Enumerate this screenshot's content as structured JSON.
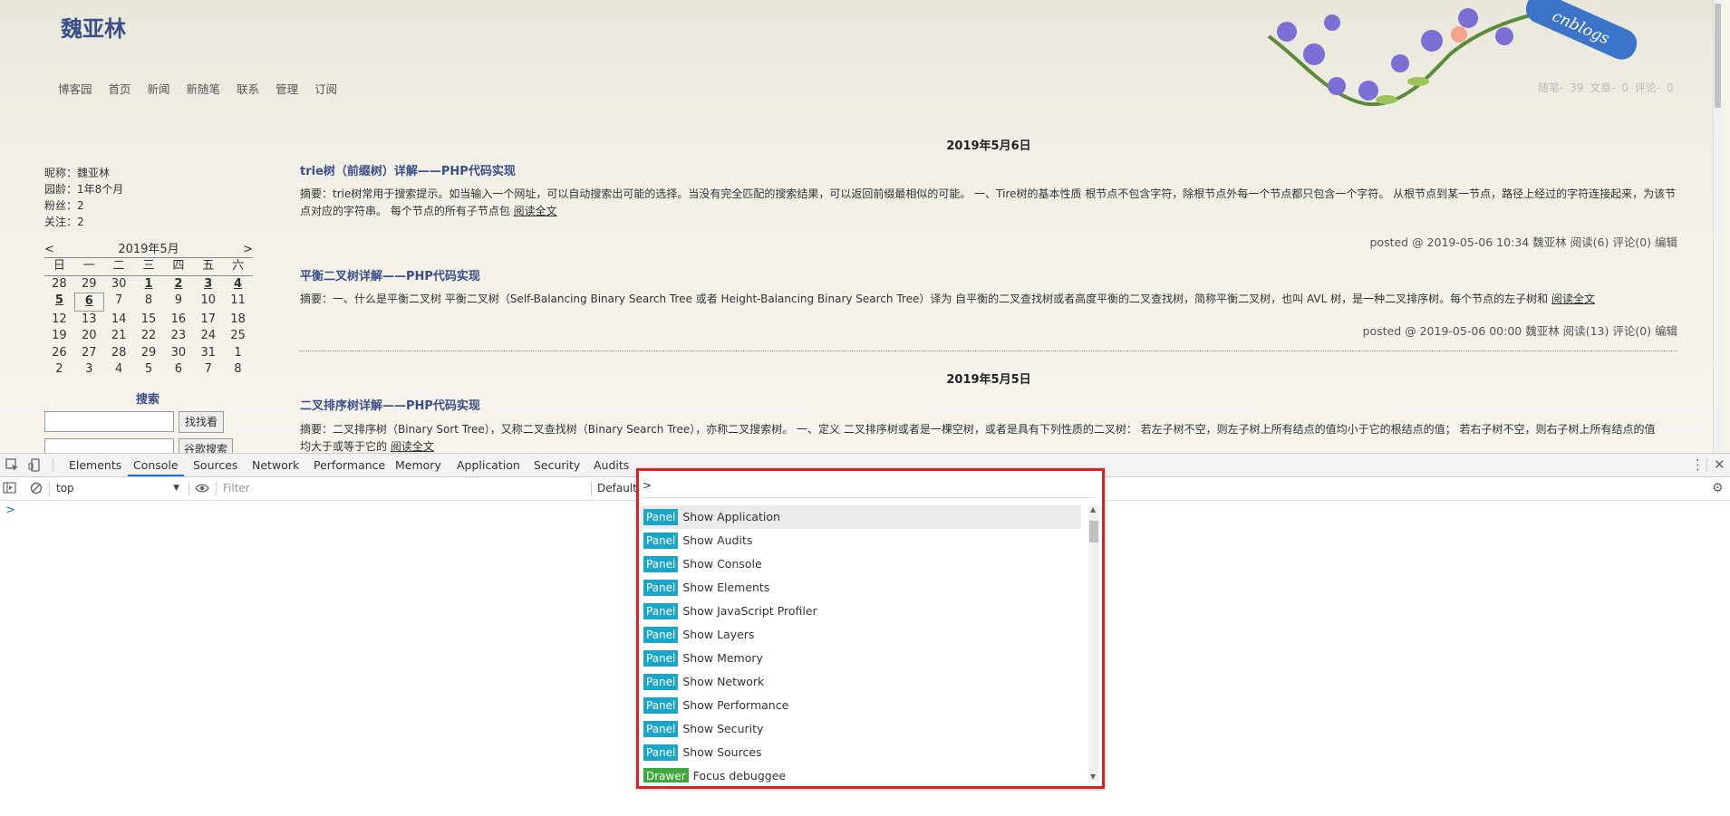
{
  "blog": {
    "title": "魏亚林",
    "nav": [
      "博客园",
      "首页",
      "新闻",
      "新随笔",
      "联系",
      "管理",
      "订阅"
    ],
    "stats": "随笔- 39  文章- 0  评论- 0",
    "logo_text": "cnblogs"
  },
  "sidebar": {
    "profile": [
      "昵称：魏亚林",
      "园龄：1年8个月",
      "粉丝：2",
      "关注：2"
    ],
    "calendar": {
      "prev": "<",
      "month": "2019年5月",
      "next": ">",
      "weekdays": [
        "日",
        "一",
        "二",
        "三",
        "四",
        "五",
        "六"
      ],
      "days": [
        "28",
        "29",
        "30",
        "1",
        "2",
        "3",
        "4",
        "5",
        "6",
        "7",
        "8",
        "9",
        "10",
        "11",
        "12",
        "13",
        "14",
        "15",
        "16",
        "17",
        "18",
        "19",
        "20",
        "21",
        "22",
        "23",
        "24",
        "25",
        "26",
        "27",
        "28",
        "29",
        "30",
        "31",
        "1",
        "2",
        "3",
        "4",
        "5",
        "6",
        "7",
        "8"
      ],
      "linked_days": [
        3,
        4,
        5,
        6,
        7,
        8
      ],
      "today_index": 8
    },
    "search_title": "搜索",
    "search_button": "找找看",
    "google_button": "谷歌搜索"
  },
  "posts": {
    "date1": "2019年5月6日",
    "p1_title": "trie树（前缀树）详解——PHP代码实现",
    "p1_abs_line1": "摘要：trie树常用于搜索提示。如当输入一个网址，可以自动搜索出可能的选择。当没有完全匹配的搜索结果，可以返回前缀最相似的可能。 一、Tire树的基本性质 根节点不包含字符，除根节点外每一个节点都只包含一个字符。 从根节点到某一节点，路径上经过的字符连接起来，为该节",
    "p1_abs_line2": "点对应的字符串。 每个节点的所有子节点包 ",
    "p1_foot": "posted @ 2019-05-06 10:34 魏亚林 阅读(6) 评论(0) 编辑",
    "p2_title": "平衡二叉树详解——PHP代码实现",
    "p2_abs": "摘要：一、什么是平衡二叉树 平衡二叉树（Self-Balancing Binary Search Tree 或者 Height-Balancing Binary Search Tree）译为 自平衡的二叉查找树或者高度平衡的二叉查找树，简称平衡二叉树，也叫 AVL 树，是一种二叉排序树。每个节点的左子树和 ",
    "p2_foot": "posted @ 2019-05-06 00:00 魏亚林 阅读(13) 评论(0) 编辑",
    "date2": "2019年5月5日",
    "p3_title": "二叉排序树详解——PHP代码实现",
    "p3_abs_line1": "摘要：二叉排序树（Binary Sort Tree），又称二叉查找树（Binary Search Tree），亦称二叉搜索树。 一、定义 二叉排序树或者是一棵空树，或者是具有下列性质的二叉树： 若左子树不空，则左子树上所有结点的值均小于它的根结点的值； 若右子树不空，则右子树上所有结点的值",
    "p3_abs_line2": "均大于或等于它的 ",
    "read_more": "阅读全文"
  },
  "devtools": {
    "tabs": [
      "Elements",
      "Console",
      "Sources",
      "Network",
      "Performance",
      "Memory",
      "Application",
      "Security",
      "Audits"
    ],
    "active_tab": "Console",
    "context": "top",
    "filter_placeholder": "Filter",
    "levels": "Default",
    "prompt": ">",
    "command_input": ">",
    "commands": [
      {
        "badge": "Panel",
        "label": "Show Application"
      },
      {
        "badge": "Panel",
        "label": "Show Audits"
      },
      {
        "badge": "Panel",
        "label": "Show Console"
      },
      {
        "badge": "Panel",
        "label": "Show Elements"
      },
      {
        "badge": "Panel",
        "label": "Show JavaScript Profiler"
      },
      {
        "badge": "Panel",
        "label": "Show Layers"
      },
      {
        "badge": "Panel",
        "label": "Show Memory"
      },
      {
        "badge": "Panel",
        "label": "Show Network"
      },
      {
        "badge": "Panel",
        "label": "Show Performance"
      },
      {
        "badge": "Panel",
        "label": "Show Security"
      },
      {
        "badge": "Panel",
        "label": "Show Sources"
      },
      {
        "badge": "Drawer",
        "label": "Focus debuggee"
      }
    ],
    "colors": {
      "panel_badge": "#1ba5c6",
      "drawer_badge": "#3ea73e",
      "highlight_border": "#e02020",
      "accent": "#1a73e8"
    }
  }
}
